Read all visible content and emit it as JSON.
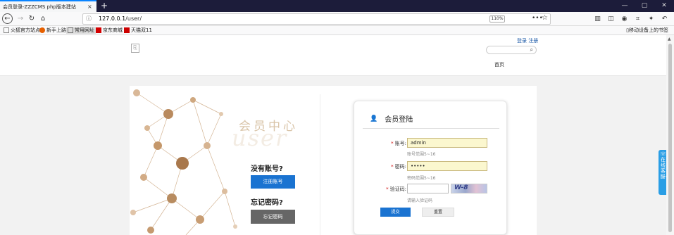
{
  "browser": {
    "tab_title": "会员登录-ZZZCMS php版本建站",
    "tab_close": "×",
    "new_tab": "+",
    "window_buttons": [
      "—",
      "▢",
      "✕"
    ],
    "url_prefix": "127.0.0.1",
    "url_path": "/user/",
    "zoom": "110%",
    "more": "•••",
    "star": "☆"
  },
  "bookmarks": {
    "items": [
      {
        "label": "火狐官方站点",
        "color": "#888"
      },
      {
        "label": "新手上路",
        "color": "#e66000"
      },
      {
        "label": "常用网址",
        "color": "#777"
      },
      {
        "label": "京东商城",
        "color": "#d40000"
      },
      {
        "label": "天猫双11",
        "color": "#c00"
      }
    ],
    "mobile": "移动设备上的书签"
  },
  "page": {
    "top_links": "登录 注册",
    "nav_home": "首页",
    "art_title": "会员中心",
    "art_watermark": "user",
    "no_account": "没有账号?",
    "register_btn": "注册账号",
    "forgot": "忘记密码?",
    "forgot_btn": "忘记密码"
  },
  "login": {
    "title": "会员登陆",
    "account_label": "账号:",
    "account_value": "admin",
    "account_hint": "账号范围5~16",
    "password_label": "密码:",
    "password_value": "•••••",
    "password_hint": "密码范围5~16",
    "captcha_label": "验证码:",
    "captcha_hint": "请输入验证码",
    "captcha_chars": "W-8",
    "submit": "提交",
    "reset": "重置"
  },
  "side_service": "在线客服«",
  "colors": {
    "accent": "#1a73d1",
    "side": "#2a9ee5"
  }
}
